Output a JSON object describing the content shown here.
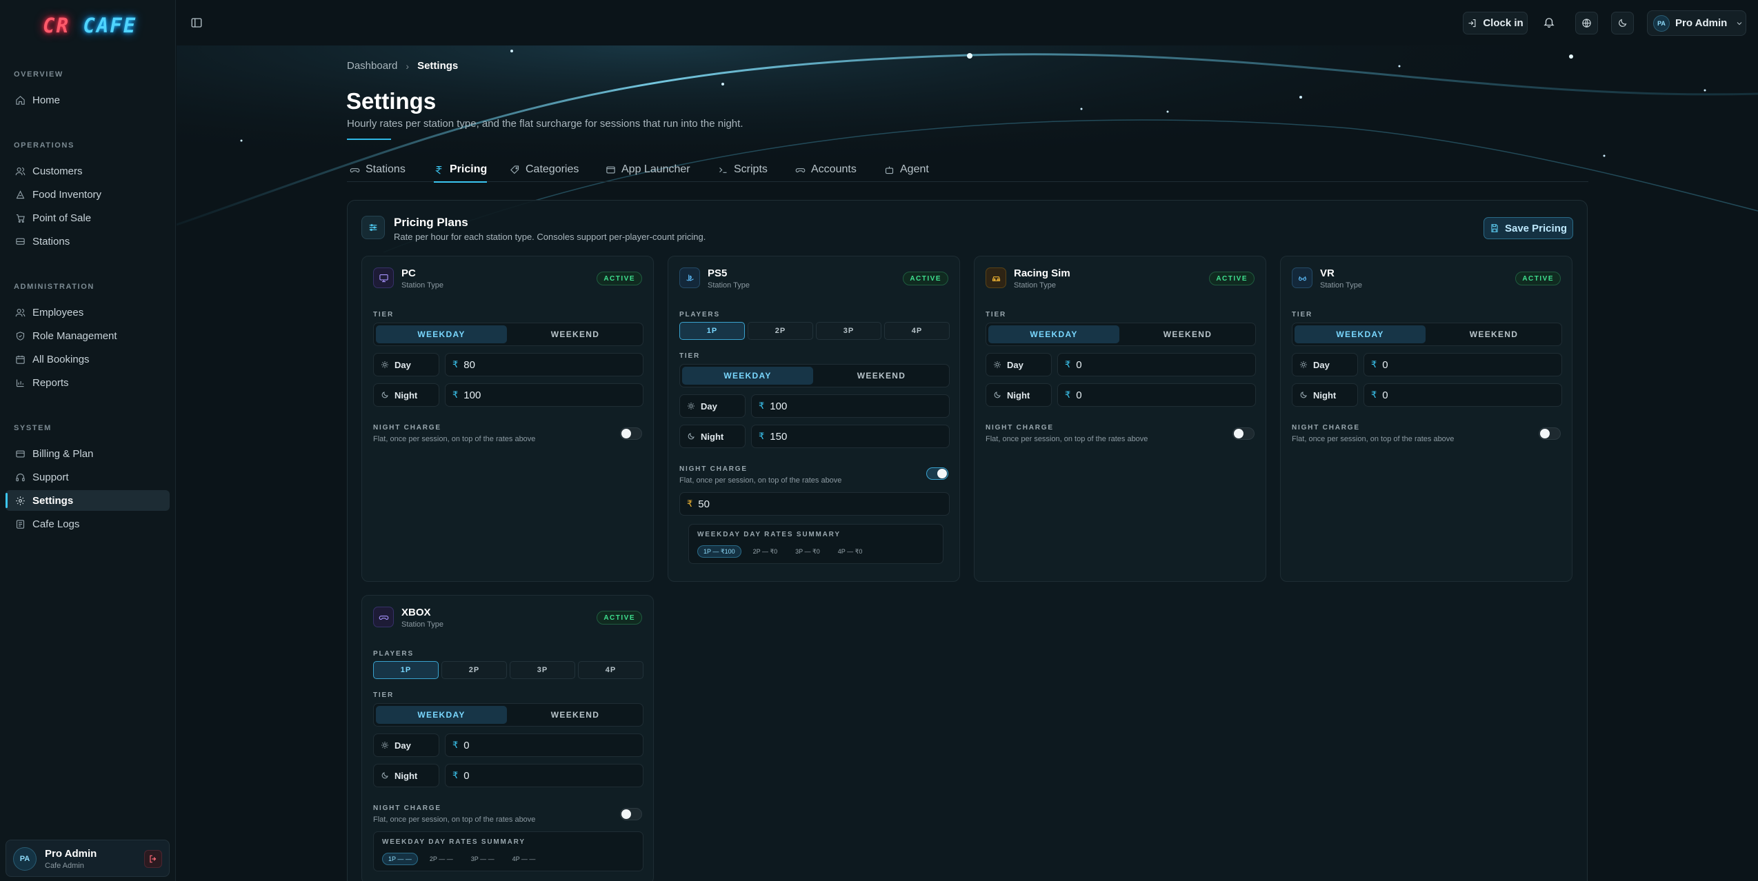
{
  "brand": {
    "logo_left": "CR",
    "logo_right": "CAFE"
  },
  "sidebar": {
    "sections": [
      {
        "title": "OVERVIEW",
        "items": [
          {
            "label": "Home",
            "icon": "home-icon"
          }
        ]
      },
      {
        "title": "OPERATIONS",
        "items": [
          {
            "label": "Customers",
            "icon": "users-icon"
          },
          {
            "label": "Food Inventory",
            "icon": "food-icon"
          },
          {
            "label": "Point of Sale",
            "icon": "cart-icon"
          },
          {
            "label": "Stations",
            "icon": "monitor-icon"
          }
        ]
      },
      {
        "title": "ADMINISTRATION",
        "items": [
          {
            "label": "Employees",
            "icon": "users-icon"
          },
          {
            "label": "Role Management",
            "icon": "shield-icon"
          },
          {
            "label": "All Bookings",
            "icon": "calendar-icon"
          },
          {
            "label": "Reports",
            "icon": "bar-chart-icon"
          }
        ]
      },
      {
        "title": "SYSTEM",
        "items": [
          {
            "label": "Billing & Plan",
            "icon": "credit-card-icon"
          },
          {
            "label": "Support",
            "icon": "headphones-icon"
          },
          {
            "label": "Settings",
            "icon": "gear-icon",
            "active": true
          },
          {
            "label": "Cafe Logs",
            "icon": "log-icon"
          }
        ]
      }
    ],
    "user": {
      "initials": "PA",
      "name": "Pro Admin",
      "role": "Cafe Admin"
    }
  },
  "topbar": {
    "clock_in": "Clock in",
    "profile_initials": "PA",
    "profile_name": "Pro Admin"
  },
  "header": {
    "breadcrumb": [
      "Dashboard",
      "Settings"
    ],
    "title": "Settings",
    "subtitle": "Hourly rates per station type, and the flat surcharge for sessions that run into the night."
  },
  "tabs": [
    {
      "label": "Stations",
      "icon": "gamepad-icon"
    },
    {
      "label": "Pricing",
      "icon": "rupee-icon",
      "active": true
    },
    {
      "label": "Categories",
      "icon": "tag-icon"
    },
    {
      "label": "App Launcher",
      "icon": "app-window-icon"
    },
    {
      "label": "Scripts",
      "icon": "terminal-icon"
    },
    {
      "label": "Accounts",
      "icon": "gamepad-icon"
    },
    {
      "label": "Agent",
      "icon": "bot-icon"
    }
  ],
  "panel": {
    "title": "Pricing Plans",
    "subtitle": "Rate per hour for each station type. Consoles support per-player-count pricing.",
    "save_label": "Save Pricing"
  },
  "labels": {
    "station_type": "Station Type",
    "active": "ACTIVE",
    "tier": "TIER",
    "players": "PLAYERS",
    "weekday": "WEEKDAY",
    "weekend": "WEEKEND",
    "day": "Day",
    "night": "Night",
    "currency": "₹",
    "night_charge": "NIGHT CHARGE",
    "night_charge_sub": "Flat, once per session, on top of the rates above",
    "summary_title": "WEEKDAY DAY RATES SUMMARY",
    "player_options": [
      "1P",
      "2P",
      "3P",
      "4P"
    ]
  },
  "cards": {
    "pc": {
      "name": "PC",
      "day": "80",
      "night": "100",
      "night_charge_on": false
    },
    "ps5": {
      "name": "PS5",
      "day": "100",
      "night": "150",
      "night_charge_on": true,
      "night_charge_value": "50",
      "summary": [
        "1P — ₹100",
        "2P — ₹0",
        "3P — ₹0",
        "4P — ₹0"
      ]
    },
    "racing": {
      "name": "Racing Sim",
      "day": "0",
      "night": "0",
      "night_charge_on": false
    },
    "vr": {
      "name": "VR",
      "day": "0",
      "night": "0",
      "night_charge_on": false
    },
    "xbox": {
      "name": "XBOX",
      "day": "0",
      "night": "0",
      "night_charge_on": false,
      "summary": [
        "1P — —",
        "2P — —",
        "3P — —",
        "4P — —"
      ]
    }
  },
  "colors": {
    "accent": "#3cc7f2",
    "active_badge": "#3ee08f",
    "logo_red": "#ff5a6a",
    "logo_cyan": "#4fd4ff"
  }
}
